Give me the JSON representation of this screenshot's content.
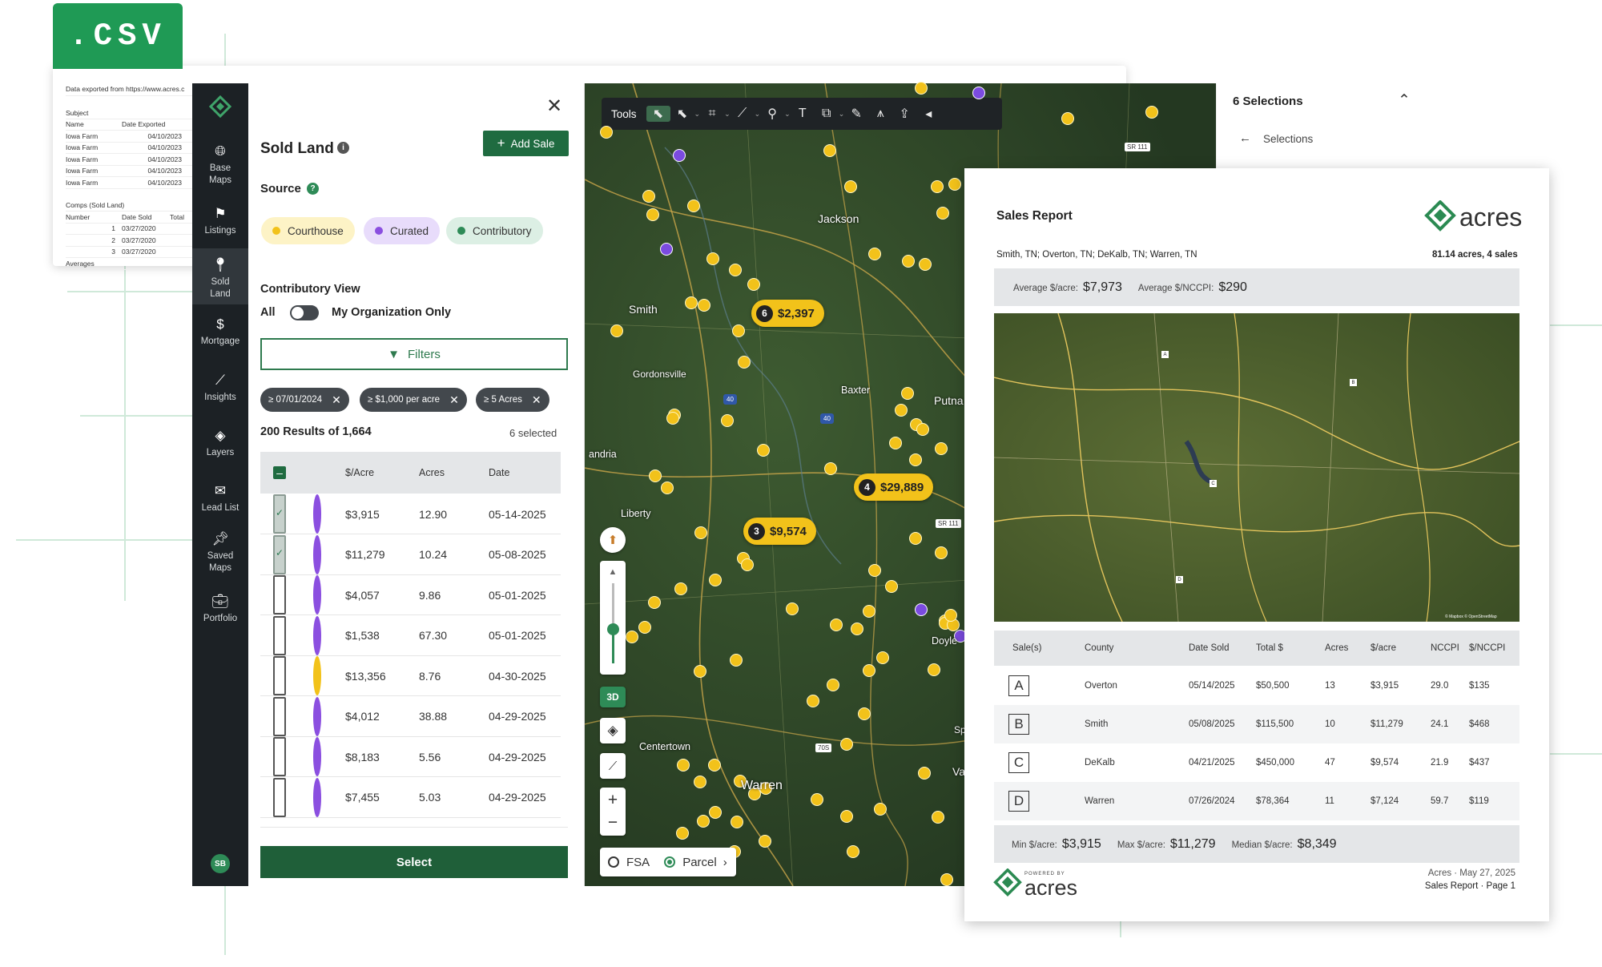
{
  "csv": {
    "tab": ".CSV",
    "header_line": "Data exported from https://www.acres.c",
    "subject": "Subject",
    "col_name": "Name",
    "col_date": "Date Exported",
    "farms": [
      {
        "name": "Iowa Farm",
        "date": "04/10/2023"
      },
      {
        "name": "Iowa Farm",
        "date": "04/10/2023"
      },
      {
        "name": "Iowa Farm",
        "date": "04/10/2023"
      },
      {
        "name": "Iowa Farm",
        "date": "04/10/2023"
      },
      {
        "name": "Iowa Farm",
        "date": "04/10/2023"
      }
    ],
    "comps_title": "Comps (Sold Land)",
    "col_number": "Number",
    "col_date_sold": "Date Sold",
    "col_total": "Total",
    "comps": [
      {
        "n": "1",
        "date": "03/27/2020"
      },
      {
        "n": "2",
        "date": "03/27/2020"
      },
      {
        "n": "3",
        "date": "03/27/2020"
      }
    ],
    "averages": "Averages"
  },
  "rail": {
    "items": [
      {
        "label1": "Base",
        "label2": "Maps"
      },
      {
        "label1": "Listings",
        "label2": ""
      },
      {
        "label1": "Sold",
        "label2": "Land"
      },
      {
        "label1": "Mortgage",
        "label2": ""
      },
      {
        "label1": "Insights",
        "label2": ""
      },
      {
        "label1": "Layers",
        "label2": ""
      },
      {
        "label1": "Lead List",
        "label2": ""
      },
      {
        "label1": "Saved",
        "label2": "Maps"
      },
      {
        "label1": "Portfolio",
        "label2": ""
      }
    ],
    "avatar": "SB"
  },
  "panel": {
    "title": "Sold Land",
    "add_sale": "Add Sale",
    "source_label": "Source",
    "sources": [
      "Courthouse",
      "Curated",
      "Contributory"
    ],
    "contributory_view": "Contributory View",
    "toggle_all": "All",
    "toggle_org": "My Organization Only",
    "filters": "Filters",
    "filter_chips": [
      "≥ 07/01/2024",
      "≥ $1,000 per acre",
      "≥ 5 Acres"
    ],
    "results": "200 Results of 1,664",
    "selected": "6 selected",
    "columns": [
      "$/Acre",
      "Acres",
      "Date"
    ],
    "rows": [
      {
        "price": "$3,915",
        "acres": "12.90",
        "date": "05-14-2025",
        "checked": true,
        "color": "#8b4fe0"
      },
      {
        "price": "$11,279",
        "acres": "10.24",
        "date": "05-08-2025",
        "checked": true,
        "color": "#8b4fe0"
      },
      {
        "price": "$4,057",
        "acres": "9.86",
        "date": "05-01-2025",
        "checked": false,
        "color": "#8b4fe0"
      },
      {
        "price": "$1,538",
        "acres": "67.30",
        "date": "05-01-2025",
        "checked": false,
        "color": "#8b4fe0"
      },
      {
        "price": "$13,356",
        "acres": "8.76",
        "date": "04-30-2025",
        "checked": false,
        "color": "#f2c21a"
      },
      {
        "price": "$4,012",
        "acres": "38.88",
        "date": "04-29-2025",
        "checked": false,
        "color": "#8b4fe0"
      },
      {
        "price": "$8,183",
        "acres": "5.56",
        "date": "04-29-2025",
        "checked": false,
        "color": "#8b4fe0"
      },
      {
        "price": "$7,455",
        "acres": "5.03",
        "date": "04-29-2025",
        "checked": false,
        "color": "#8b4fe0"
      }
    ],
    "select_button": "Select"
  },
  "map": {
    "tools_label": "Tools",
    "towns": [
      "Jackson",
      "Smith",
      "Gordonsville",
      "Baxter",
      "Putna",
      "andria",
      "Liberty",
      "Doyle",
      "Centertown",
      "Warren",
      "Va",
      "Sp"
    ],
    "bubbles": [
      {
        "n": "6",
        "price": "$2,397"
      },
      {
        "n": "4",
        "price": "$29,889"
      },
      {
        "n": "3",
        "price": "$9,574"
      }
    ],
    "badge_3d": "3D",
    "layer_fsa": "FSA",
    "layer_parcel": "Parcel",
    "road_labels": [
      "SR 111",
      "SR 111",
      "40",
      "40",
      "70S"
    ]
  },
  "selections": {
    "title": "6 Selections",
    "back_label": "Selections"
  },
  "report": {
    "title": "Sales Report",
    "brand": "acres",
    "counties": "Smith, TN; Overton, TN; DeKalb, TN; Warren, TN",
    "summary": "81.14 acres, 4 sales",
    "avg_acre_label": "Average $/acre:",
    "avg_acre": "$7,973",
    "avg_nccpi_label": "Average $/NCCPI:",
    "avg_nccpi": "$290",
    "columns": [
      "Sale(s)",
      "County",
      "Date Sold",
      "Total $",
      "Acres",
      "$/acre",
      "NCCPI",
      "$/NCCPI"
    ],
    "rows": [
      {
        "sale": "A",
        "county": "Overton",
        "date": "05/14/2025",
        "total": "$50,500",
        "acres": "13",
        "per_acre": "$3,915",
        "nccpi": "29.0",
        "per_nccpi": "$135"
      },
      {
        "sale": "B",
        "county": "Smith",
        "date": "05/08/2025",
        "total": "$115,500",
        "acres": "10",
        "per_acre": "$11,279",
        "nccpi": "24.1",
        "per_nccpi": "$468"
      },
      {
        "sale": "C",
        "county": "DeKalb",
        "date": "04/21/2025",
        "total": "$450,000",
        "acres": "47",
        "per_acre": "$9,574",
        "nccpi": "21.9",
        "per_nccpi": "$437"
      },
      {
        "sale": "D",
        "county": "Warren",
        "date": "07/26/2024",
        "total": "$78,364",
        "acres": "11",
        "per_acre": "$7,124",
        "nccpi": "59.7",
        "per_nccpi": "$119"
      }
    ],
    "min_label": "Min $/acre:",
    "min": "$3,915",
    "max_label": "Max $/acre:",
    "max": "$11,279",
    "median_label": "Median $/acre:",
    "median": "$8,349",
    "powered_by": "POWERED BY",
    "footer_brand": "acres",
    "footer_meta1": "Acres  ·  May 27, 2025",
    "footer_meta2": "Sales Report  ·  Page 1",
    "map_markers": [
      "A",
      "B",
      "C",
      "D"
    ],
    "map_attribution": "© Mapbox © OpenStreetMap"
  },
  "colors": {
    "brand_green": "#1f6b40",
    "csv_green": "#1f9a55",
    "pin_yellow": "#f2c21a",
    "pin_purple": "#7b4be0",
    "rail_dark": "#1c2125"
  }
}
